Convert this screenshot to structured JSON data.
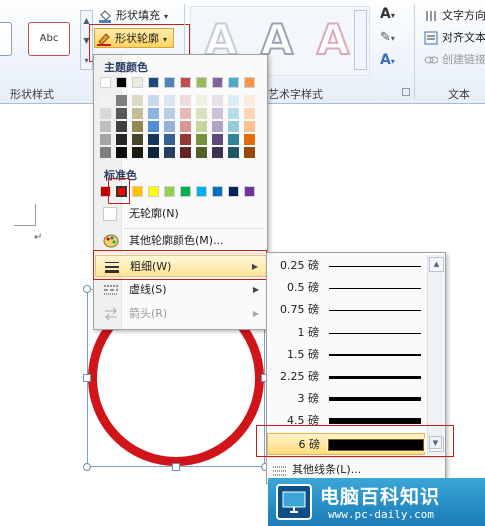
{
  "ribbon": {
    "shape_styles": {
      "label": "形状样式",
      "sample_label": "Abc",
      "fill_label": "形状填充",
      "outline_label": "形状轮廓"
    },
    "wordart_styles": {
      "label": "艺术字样式",
      "letter": "A"
    },
    "text": {
      "label": "文本",
      "direction_label": "文字方向",
      "align_label": "对齐文本",
      "link_label": "创建链接"
    }
  },
  "outline_menu": {
    "theme_colors_title": "主题颜色",
    "standard_colors_title": "标准色",
    "no_outline_label": "无轮廓(N)",
    "more_colors_label": "其他轮廓颜色(M)...",
    "weight_label": "粗细(W)",
    "dashes_label": "虚线(S)",
    "arrows_label": "箭头(R)",
    "theme_colors_top": [
      "#ffffff",
      "#000000",
      "#eeece1",
      "#1f497d",
      "#4f81bd",
      "#c0504d",
      "#9bbb59",
      "#8064a2",
      "#4bacc6",
      "#f79646"
    ],
    "theme_colors_shades": [
      [
        "#f2f2f2",
        "#7f7f7f",
        "#ddd9c3",
        "#c6d9f0",
        "#dbe5f1",
        "#f2dcdb",
        "#ebf1dd",
        "#e5e0ec",
        "#dbeef3",
        "#fdeada"
      ],
      [
        "#d8d8d8",
        "#595959",
        "#c4bd97",
        "#8db3e2",
        "#b8cce4",
        "#e5b9b7",
        "#d7e3bc",
        "#ccc1d9",
        "#b7dde8",
        "#fbd5b5"
      ],
      [
        "#bfbfbf",
        "#3f3f3f",
        "#938953",
        "#548dd4",
        "#95b3d7",
        "#d99694",
        "#c3d69b",
        "#b2a2c7",
        "#92cddc",
        "#fac08f"
      ],
      [
        "#a5a5a5",
        "#262626",
        "#494429",
        "#17365d",
        "#366092",
        "#953734",
        "#76923c",
        "#5f497a",
        "#31859b",
        "#e36c09"
      ],
      [
        "#7f7f7f",
        "#0c0c0c",
        "#1d1b10",
        "#0f243e",
        "#244061",
        "#632423",
        "#4f6128",
        "#3f3151",
        "#205867",
        "#974806"
      ]
    ],
    "standard_colors": [
      "#c00000",
      "#ff0000",
      "#ffc000",
      "#ffff00",
      "#92d050",
      "#00b050",
      "#00b0f0",
      "#0070c0",
      "#002060",
      "#7030a0"
    ],
    "selected_standard_color": "#ff0000"
  },
  "weight_submenu": {
    "unit": "磅",
    "weights": [
      "0.25",
      "0.5",
      "0.75",
      "1",
      "1.5",
      "2.25",
      "3",
      "4.5",
      "6"
    ],
    "selected": "6",
    "more_lines_label": "其他线条(L)..."
  },
  "shape": {
    "outline_color": "#d0141a"
  },
  "watermark": {
    "title": "电脑百科知识",
    "url": "www.pc-daily.com"
  }
}
